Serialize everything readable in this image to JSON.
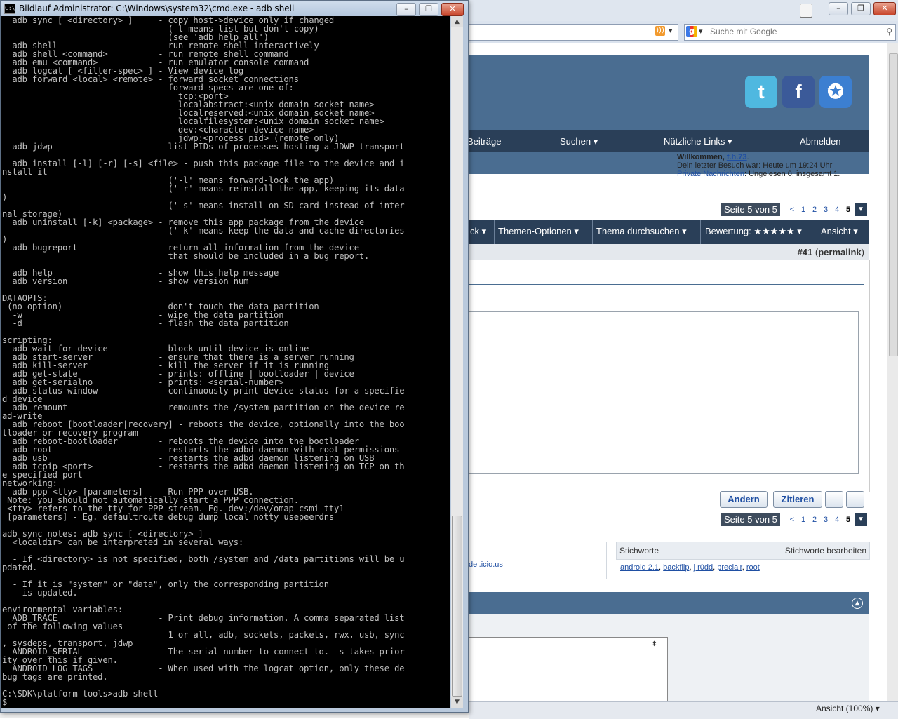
{
  "cmd": {
    "title": "Bildlauf Administrator: C:\\Windows\\system32\\cmd.exe - adb  shell",
    "icon_label": "C:\\",
    "controls": {
      "minimize": "–",
      "maximize": "❐",
      "close": "✕"
    },
    "console_lines": [
      "  adb sync [ <directory> ]     - copy host->device only if changed",
      "                                 (-l means list but don't copy)",
      "                                 (see 'adb help all')",
      "  adb shell                    - run remote shell interactively",
      "  adb shell <command>          - run remote shell command",
      "  adb emu <command>            - run emulator console command",
      "  adb logcat [ <filter-spec> ] - View device log",
      "  adb forward <local> <remote> - forward socket connections",
      "                                 forward specs are one of:",
      "                                   tcp:<port>",
      "                                   localabstract:<unix domain socket name>",
      "                                   localreserved:<unix domain socket name>",
      "                                   localfilesystem:<unix domain socket name>",
      "                                   dev:<character device name>",
      "                                   jdwp:<process pid> (remote only)",
      "  adb jdwp                     - list PIDs of processes hosting a JDWP transport",
      "",
      "  adb install [-l] [-r] [-s] <file> - push this package file to the device and i",
      "nstall it",
      "                                 ('-l' means forward-lock the app)",
      "                                 ('-r' means reinstall the app, keeping its data",
      ")",
      "                                 ('-s' means install on SD card instead of inter",
      "nal storage)",
      "  adb uninstall [-k] <package> - remove this app package from the device",
      "                                 ('-k' means keep the data and cache directories",
      ")",
      "  adb bugreport                - return all information from the device",
      "                                 that should be included in a bug report.",
      "",
      "  adb help                     - show this help message",
      "  adb version                  - show version num",
      "",
      "DATAOPTS:",
      " (no option)                   - don't touch the data partition",
      "  -w                           - wipe the data partition",
      "  -d                           - flash the data partition",
      "",
      "scripting:",
      "  adb wait-for-device          - block until device is online",
      "  adb start-server             - ensure that there is a server running",
      "  adb kill-server              - kill the server if it is running",
      "  adb get-state                - prints: offline | bootloader | device",
      "  adb get-serialno             - prints: <serial-number>",
      "  adb status-window            - continuously print device status for a specifie",
      "d device",
      "  adb remount                  - remounts the /system partition on the device re",
      "ad-write",
      "  adb reboot [bootloader|recovery] - reboots the device, optionally into the boo",
      "tloader or recovery program",
      "  adb reboot-bootloader        - reboots the device into the bootloader",
      "  adb root                     - restarts the adbd daemon with root permissions",
      "  adb usb                      - restarts the adbd daemon listening on USB",
      "  adb tcpip <port>             - restarts the adbd daemon listening on TCP on th",
      "e specified port",
      "networking:",
      "  adb ppp <tty> [parameters]   - Run PPP over USB.",
      " Note: you should not automatically start a PPP connection.",
      " <tty> refers to the tty for PPP stream. Eg. dev:/dev/omap_csmi_tty1",
      " [parameters] - Eg. defaultroute debug dump local notty usepeerdns",
      "",
      "adb sync notes: adb sync [ <directory> ]",
      "  <localdir> can be interpreted in several ways:",
      "",
      "  - If <directory> is not specified, both /system and /data partitions will be u",
      "pdated.",
      "",
      "  - If it is \"system\" or \"data\", only the corresponding partition",
      "    is updated.",
      "",
      "environmental variables:",
      "  ADB_TRACE                    - Print debug information. A comma separated list",
      " of the following values",
      "                                 1 or all, adb, sockets, packets, rwx, usb, sync",
      ", sysdeps, transport, jdwp",
      "  ANDROID_SERIAL               - The serial number to connect to. -s takes prior",
      "ity over this if given.",
      "  ANDROID_LOG_TAGS             - When used with the logcat option, only these de",
      "bug tags are printed.",
      "",
      "C:\\SDK\\platform-tools>adb shell",
      "$"
    ],
    "scroll": {
      "up": "▲",
      "down": "▼"
    }
  },
  "browser": {
    "controls": {
      "minimize": "–",
      "maximize": "❐",
      "close": "✕"
    },
    "rss_icon": "rss-icon",
    "rss_glyph": ")))",
    "search": {
      "engine_glyph": "g",
      "placeholder": "Suche mit Google",
      "go": "⚲",
      "dropdown": "▾"
    },
    "zoom": "Ansicht (100%) ▾",
    "social": [
      {
        "name": "twitter-icon",
        "glyph": "t",
        "color": "#4fb8e0"
      },
      {
        "name": "facebook-icon",
        "glyph": "f",
        "color": "#3b5a99"
      },
      {
        "name": "android-icon",
        "glyph": "✪",
        "color": "#3c7fd1"
      }
    ],
    "nav": [
      "Beiträge",
      "Suchen ▾",
      "Nützliche Links ▾",
      "Abmelden"
    ],
    "welcome": {
      "prefix": "Willkommen, ",
      "user": "f.h.73",
      "suffix": ".",
      "last_visit": "Dein letzter Besuch war: Heute um 19:24 Uhr",
      "pm_link": "Private Nachrichten",
      "pm_text": ": Ungelesen 0, insgesamt 1."
    },
    "pager": {
      "label": "Seite 5 von 5",
      "prev": "<",
      "pages": [
        "1",
        "2",
        "3",
        "4",
        "5"
      ],
      "current": "5",
      "menu": "▼"
    },
    "thread_tools": [
      "ck ▾",
      "Themen-Optionen ▾",
      "Thema durchsuchen ▾",
      "Bewertung: ★★★★★ ▾",
      "Ansicht ▾"
    ],
    "post_number": "#41",
    "permalink": "permalink",
    "post_actions": {
      "edit": "Ändern",
      "quote": "Zitieren"
    },
    "tags": {
      "header": "Stichworte",
      "edit": "Stichworte bearbeiten",
      "items": [
        "android 2.1",
        "backflip",
        "j r0dd",
        "preclair",
        "root"
      ],
      "social_link": "del.icio.us"
    },
    "collapse": "▲",
    "select_arrows": "⬍"
  }
}
